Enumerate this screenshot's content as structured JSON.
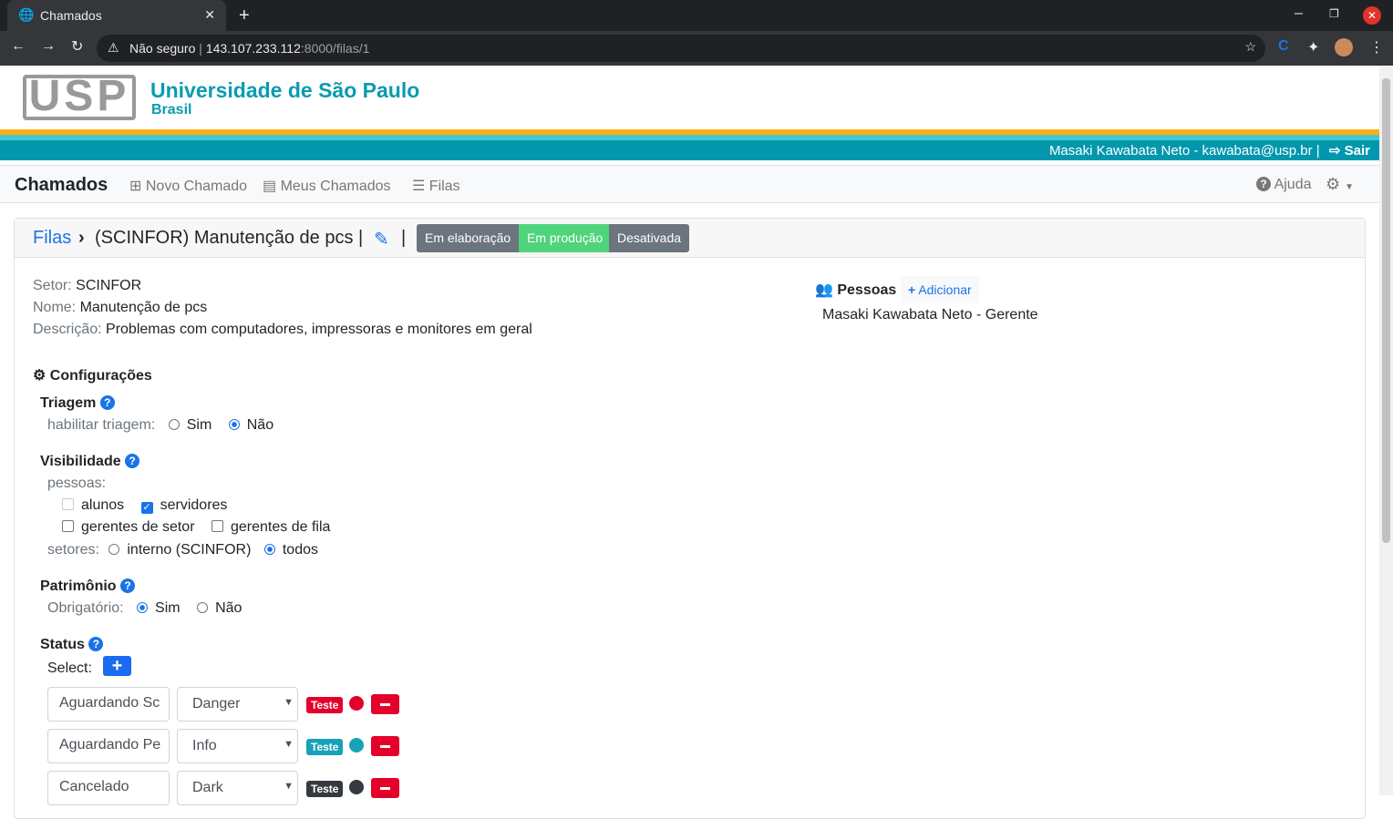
{
  "browser": {
    "tab_title": "Chamados",
    "security": "Não seguro",
    "url_host": "143.107.233.112",
    "url_path": ":8000/filas/1"
  },
  "header": {
    "university": "Universidade de São Paulo",
    "country": "Brasil",
    "logo_text": "USP",
    "user": "Masaki Kawabata Neto - kawabata@usp.br |",
    "logout": "Sair"
  },
  "nav": {
    "brand": "Chamados",
    "items": [
      "Novo Chamado",
      "Meus Chamados",
      "Filas"
    ],
    "help": "Ajuda"
  },
  "breadcrumb": {
    "root": "Filas",
    "current": "(SCINFOR) Manutenção de pcs |",
    "sep": "|"
  },
  "state_buttons": [
    {
      "label": "Em elaboração",
      "color": "#6c757d"
    },
    {
      "label": "Em produção",
      "color": "#4fd37b"
    },
    {
      "label": "Desativada",
      "color": "#6c757d"
    }
  ],
  "info": {
    "setor_label": "Setor:",
    "setor": "SCINFOR",
    "nome_label": "Nome:",
    "nome": "Manutenção de pcs",
    "descricao_label": "Descrição:",
    "descricao": "Problemas com computadores, impressoras e monitores em geral"
  },
  "pessoas": {
    "title": "Pessoas",
    "add": "Adicionar",
    "members": [
      "Masaki Kawabata Neto - Gerente"
    ]
  },
  "config": {
    "title": "Configurações",
    "triagem": {
      "title": "Triagem",
      "label": "habilitar triagem:",
      "options": [
        "Sim",
        "Não"
      ],
      "selected": "Não"
    },
    "visibilidade": {
      "title": "Visibilidade",
      "pessoas_label": "pessoas:",
      "checks": [
        {
          "label": "alunos",
          "checked": false,
          "disabled": true
        },
        {
          "label": "servidores",
          "checked": true
        },
        {
          "label": "gerentes de setor",
          "checked": false
        },
        {
          "label": "gerentes de fila",
          "checked": false
        }
      ],
      "setores_label": "setores:",
      "setores": [
        "interno (SCINFOR)",
        "todos"
      ],
      "setores_selected": "todos"
    },
    "patrimonio": {
      "title": "Patrimônio",
      "label": "Obrigatório:",
      "options": [
        "Sim",
        "Não"
      ],
      "selected": "Sim"
    },
    "status": {
      "title": "Status",
      "select_label": "Select:",
      "badge_text": "Teste",
      "rows": [
        {
          "name": "Aguardando Sc",
          "color_name": "Danger",
          "color": "#e4002b"
        },
        {
          "name": "Aguardando Pe",
          "color_name": "Info",
          "color": "#17a2b8"
        },
        {
          "name": "Cancelado",
          "color_name": "Dark",
          "color": "#343a40"
        }
      ]
    }
  }
}
